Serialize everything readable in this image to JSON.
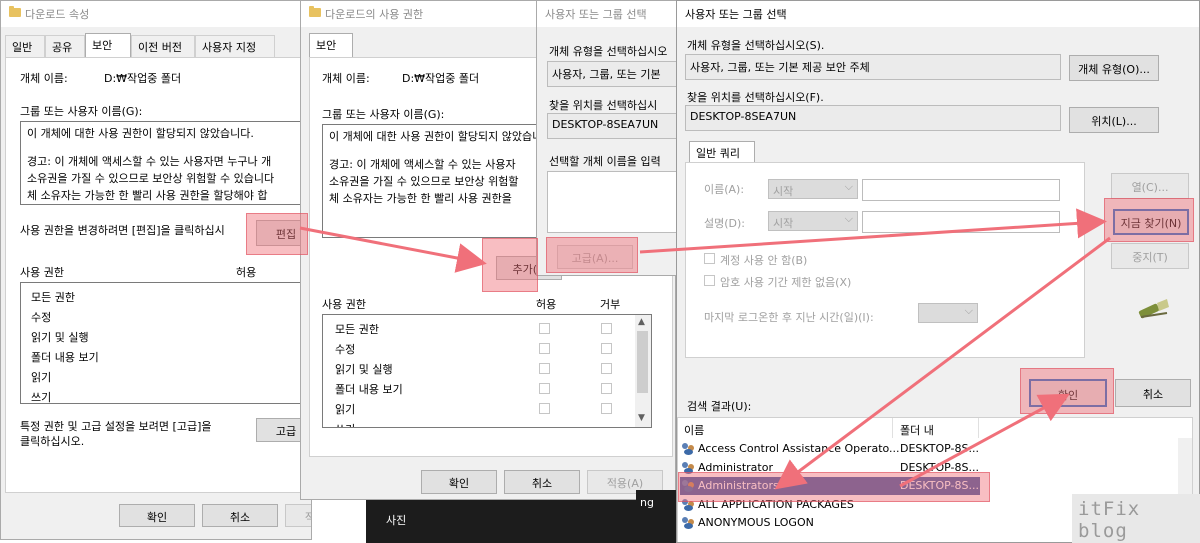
{
  "win1": {
    "title": "다운로드 속성",
    "tabs": [
      "일반",
      "공유",
      "보안",
      "이전 버전",
      "사용자 지정"
    ],
    "object_name_label": "개체 이름:",
    "object_name_value": "D:₩작업중 폴더",
    "group_label": "그룹 또는 사용자 이름(G):",
    "group_lines": [
      "이 개체에 대한 사용 권한이 할당되지 않았습니다.",
      "경고: 이 개체에 액세스할 수 있는 사용자면 누구나 개",
      "소유권을 가질 수 있으므로 보안상 위험할 수 있습니다",
      "체 소유자는 가능한 한 빨리 사용 권한을 할당해야 합"
    ],
    "change_hint": "사용 권한을 변경하려면 [편집]을 클릭하십시",
    "edit_button": "편집",
    "perm_label": "사용 권한",
    "perm_allow": "허용",
    "permissions": [
      "모든 권한",
      "수정",
      "읽기 및 실행",
      "폴더 내용 보기",
      "읽기",
      "쓰기"
    ],
    "advanced_hint_1": "특정 권한 및 고급 설정을 보려면 [고급]을",
    "advanced_hint_2": "클릭하십시오.",
    "advanced_button": "고급",
    "ok": "확인",
    "cancel": "취소",
    "apply": "적용(A)"
  },
  "win2": {
    "title": "다운로드의 사용 권한",
    "tab": "보안",
    "object_name_label": "개체 이름:",
    "object_name_value": "D:₩작업중 폴더",
    "group_label": "그룹 또는 사용자 이름(G):",
    "group_lines": [
      "이 개체에 대한 사용 권한이 할당되지 않았습니다.",
      "경고: 이 개체에 액세스할 수 있는 사용자",
      "소유권을 가질 수 있으므로 보안상 위험할",
      "체 소유자는 가능한 한 빨리 사용 권한을"
    ],
    "add_button": "추가(D",
    "perm_label": "사용 권한",
    "perm_allow": "허용",
    "perm_deny": "거부",
    "permissions": [
      "모든 권한",
      "수정",
      "읽기 및 실행",
      "폴더 내용 보기",
      "읽기",
      "쓰기"
    ],
    "ok": "확인",
    "cancel": "취소",
    "apply": "적용(A)"
  },
  "win3": {
    "title": "사용자 또는 그룹 선택",
    "obj_type_label": "개체 유형을 선택하십시오",
    "obj_type_value": "사용자, 그룹, 또는 기본",
    "location_label": "찾을 위치를 선택하십시",
    "location_value": "DESKTOP-8SEA7UN",
    "enter_label": "선택할 개체 이름을 입력",
    "advanced_button": "고급(A)..."
  },
  "win4": {
    "title": "사용자 또는 그룹 선택",
    "obj_type_label": "개체 유형을 선택하십시오(S).",
    "obj_type_value": "사용자, 그룹, 또는 기본 제공 보안 주체",
    "obj_type_button": "개체 유형(O)...",
    "location_label": "찾을 위치를 선택하십시오(F).",
    "location_value": "DESKTOP-8SEA7UN",
    "location_button": "위치(L)...",
    "tab": "일반 쿼리",
    "name_label": "이름(A):",
    "name_ddl": "시작",
    "desc_label": "설명(D):",
    "desc_ddl": "시작",
    "cb_disabled": "계정 사용 안 함(B)",
    "cb_noexpire": "암호 사용 기간 제한 없음(X)",
    "days_label": "마지막 로그온한 후 지난 시간(일)(I):",
    "col_button": "열(C)...",
    "find_button": "지금 찾기(N)",
    "stop_button": "중지(T)",
    "ok": "확인",
    "cancel": "취소",
    "results_label": "검색 결과(U):",
    "results_cols": [
      "이름",
      "폴더 내"
    ],
    "results": [
      {
        "name": "Access Control Assistance Operato...",
        "folder": "DESKTOP-8S..."
      },
      {
        "name": "Administrator",
        "folder": "DESKTOP-8S..."
      },
      {
        "name": "Administrators",
        "folder": "DESKTOP-8S..."
      },
      {
        "name": "ALL APPLICATION PACKAGES",
        "folder": ""
      },
      {
        "name": "ANONYMOUS LOGON",
        "folder": ""
      }
    ],
    "selected_row": 2
  },
  "taskbar": {
    "label_1": "ng",
    "label_2": "사진"
  },
  "watermark": "itFix blog",
  "colors": {
    "highlight": "#f06e78",
    "arrow": "#f0707a",
    "selection": "#3c5aa0",
    "default_button_border": "#1e6ec8"
  }
}
